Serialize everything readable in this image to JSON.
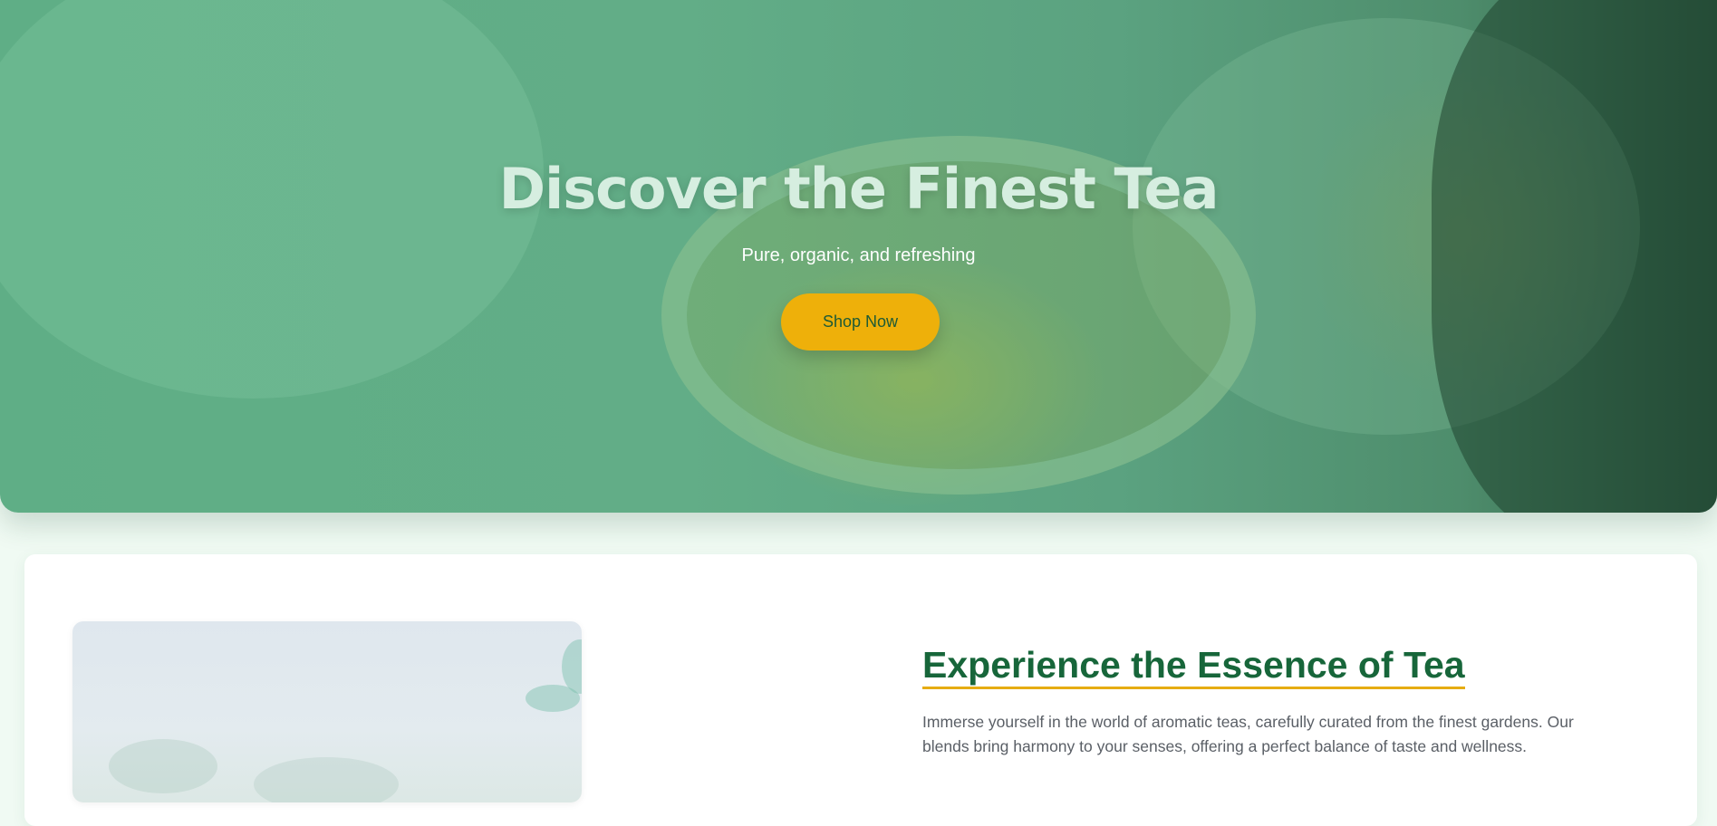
{
  "hero": {
    "title": "Discover the Finest Tea",
    "subtitle": "Pure, organic, and refreshing",
    "cta_label": "Shop Now"
  },
  "about": {
    "title": "Experience the Essence of Tea",
    "text": "Immerse yourself in the world of aromatic teas, carefully curated from the finest gardens. Our blends bring harmony to your senses, offering a perfect balance of taste and wellness."
  },
  "colors": {
    "hero_overlay": "#62ad87",
    "accent": "#eeb00a",
    "heading_green": "#17663a",
    "underline": "#e6ac12",
    "body_text": "#5a5f66",
    "page_bg": "#f0faf3"
  }
}
